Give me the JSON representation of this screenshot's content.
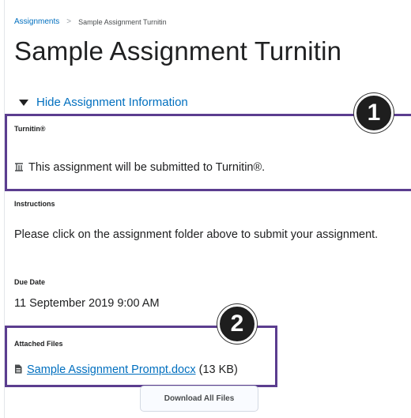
{
  "breadcrumb": {
    "parent": "Assignments",
    "separator": ">",
    "current": "Sample Assignment Turnitin"
  },
  "page": {
    "title": "Sample Assignment Turnitin"
  },
  "toggle": {
    "label": "Hide Assignment Information"
  },
  "turnitin": {
    "label": "Turnitin®",
    "text": "This assignment will be submitted to Turnitin®."
  },
  "instructions": {
    "label": "Instructions",
    "text": "Please click on the assignment folder above to submit your assignment."
  },
  "due_date": {
    "label": "Due Date",
    "value": "11 September 2019 9:00 AM"
  },
  "attached_files": {
    "label": "Attached Files",
    "file_name": "Sample Assignment Prompt.docx",
    "file_size": "(13 KB)"
  },
  "download_button": {
    "label": "Download All Files"
  },
  "callouts": {
    "one": "1",
    "two": "2"
  },
  "colors": {
    "link": "#006fbf",
    "highlight": "#5b3d8f",
    "badge": "#1e1e1e"
  },
  "icons": {
    "toggle": "triangle-down-icon",
    "turnitin": "turnitin-icon",
    "file": "document-icon"
  }
}
